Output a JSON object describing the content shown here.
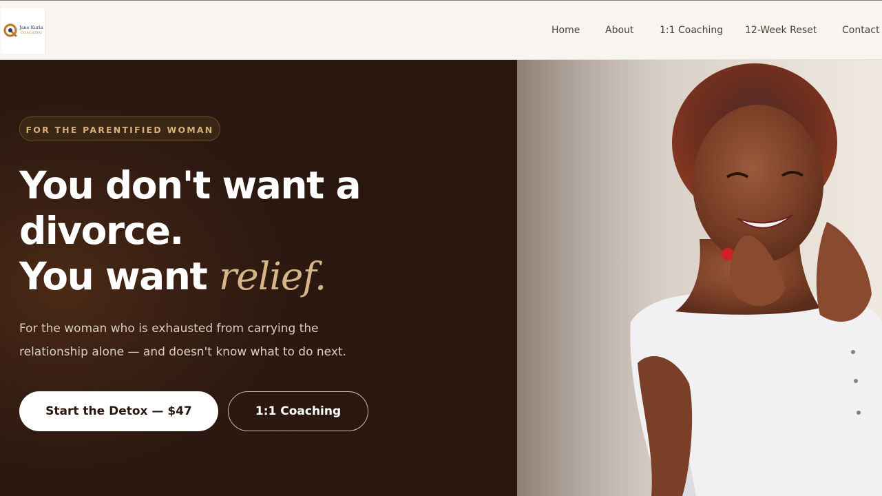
{
  "header": {
    "logo": {
      "name": "Jane Kuria",
      "tagline": "COACHING"
    },
    "nav": [
      {
        "label": "Home"
      },
      {
        "label": "About"
      },
      {
        "label": "1:1 Coaching"
      },
      {
        "label": "12-Week Reset"
      },
      {
        "label": "Contact"
      }
    ]
  },
  "hero": {
    "eyebrow": "FOR THE PARENTIFIED WOMAN",
    "headline_line1": "You don't want a",
    "headline_line2": "divorce.",
    "headline_line3_start": "You want ",
    "headline_line3_accent": "relief.",
    "subtext": "For the woman who is exhausted from carrying the relationship alone — and doesn't know what to do next.",
    "primary_cta": "Start the Detox — $47",
    "secondary_cta": "1:1 Coaching",
    "photo": "smiling-woman-portrait"
  },
  "colors": {
    "hero_background": "#2a1710",
    "accent": "#d6b689",
    "eyebrow_text": "#d6ae7a",
    "header_background": "#f8f5f0"
  }
}
